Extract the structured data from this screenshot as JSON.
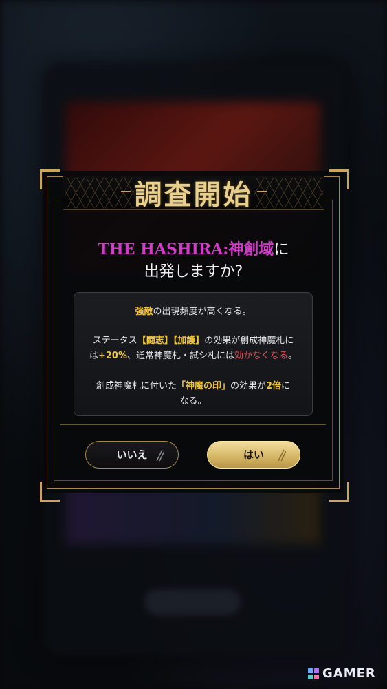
{
  "dialog": {
    "title": "調査開始",
    "question_highlight": "THE HASHIRA:神創域",
    "question_particle": "に",
    "question_line2": "出発しますか?"
  },
  "info": {
    "line1": {
      "highlight": "強敵",
      "text": "の出現頻度が高くなる。"
    },
    "line2": {
      "prefix": "ステータス",
      "tag1": "【闘志】",
      "tag2": "【加護】",
      "suffix": "の効果が創成神魔札に"
    },
    "line3": {
      "prefix": "は",
      "value": "+20%",
      "middle": "、通常神魔札・試シ札には",
      "warning": "効かなくなる",
      "end": "。"
    },
    "line4": {
      "prefix": "創成神魔札に付いた",
      "highlight": "「神魔の印」",
      "middle": "の効果が",
      "multiplier": "2倍",
      "suffix": "に"
    },
    "line5": "なる。"
  },
  "buttons": {
    "no_label": "いいえ",
    "yes_label": "はい"
  },
  "watermark": {
    "text": "GAMER",
    "icon": "gamer-logo-icon"
  },
  "colors": {
    "gold": "#c9a55e",
    "title_gold": "#e8cf8e",
    "highlight_magenta": "#d03cc7",
    "highlight_yellow": "#f1c43c",
    "warning_red": "#e6505a"
  }
}
